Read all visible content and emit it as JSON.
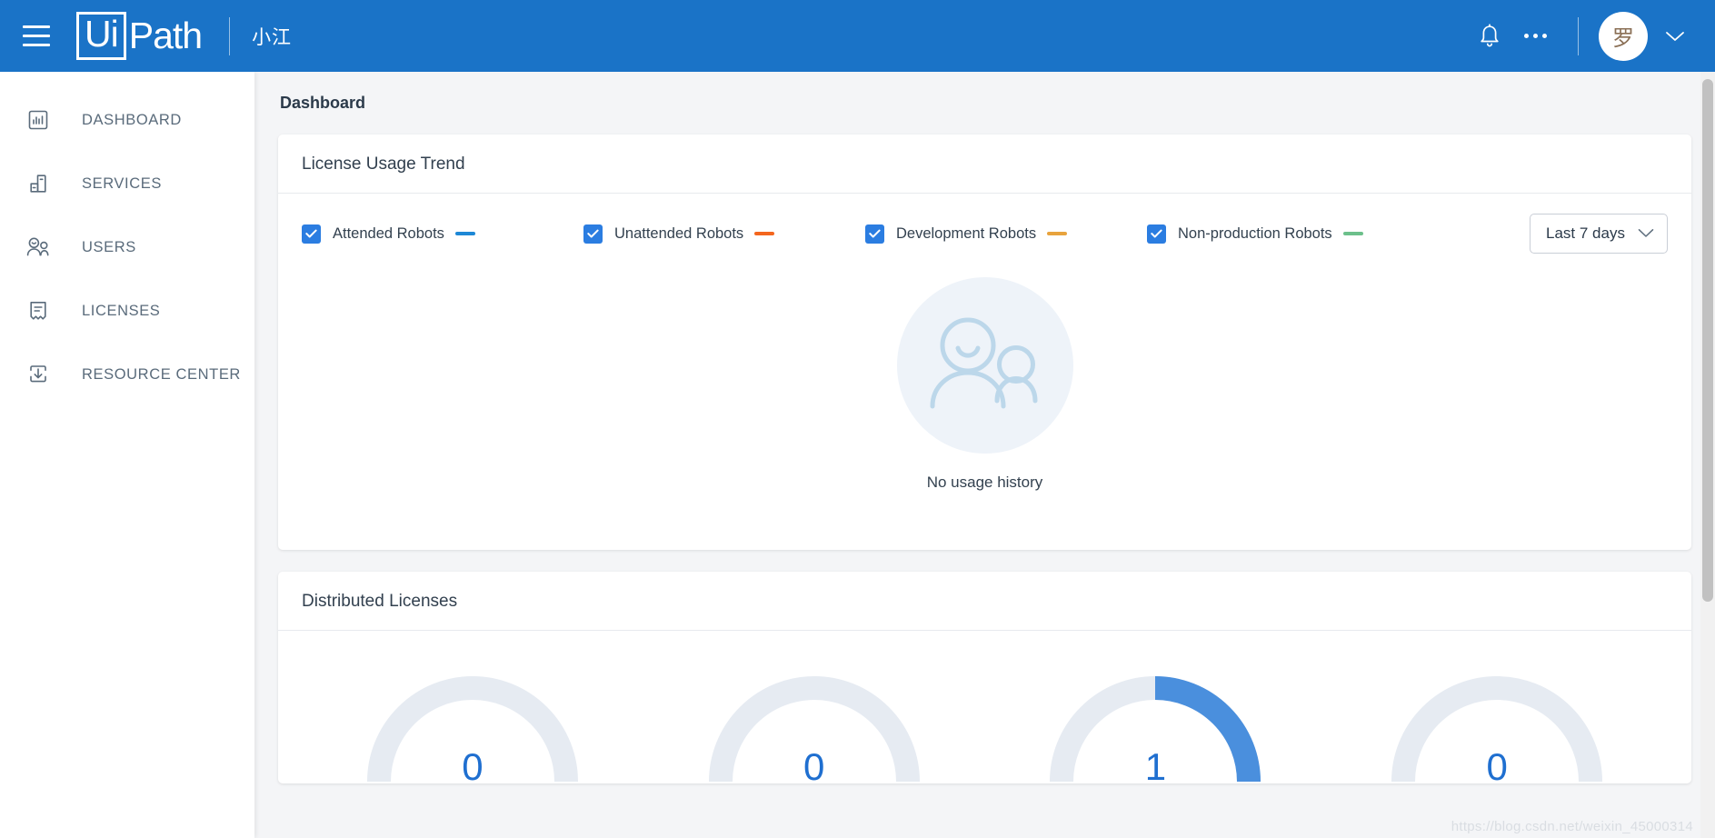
{
  "topbar": {
    "menu_icon": "hamburger-icon",
    "logo_mark": "Ui",
    "logo_word": "Path",
    "tenant": "小江",
    "notifications_icon": "bell-icon",
    "more_icon": "more-horizontal-icon",
    "avatar_initial": "罗",
    "account_caret_icon": "chevron-down-icon",
    "brand_color": "#1a73c7"
  },
  "sidebar": {
    "items": [
      {
        "label": "DASHBOARD",
        "icon": "chart-bars-icon"
      },
      {
        "label": "SERVICES",
        "icon": "services-blocks-icon"
      },
      {
        "label": "USERS",
        "icon": "users-icon"
      },
      {
        "label": "LICENSES",
        "icon": "license-ribbon-icon"
      },
      {
        "label": "RESOURCE CENTER",
        "icon": "download-box-icon"
      }
    ]
  },
  "page": {
    "title": "Dashboard"
  },
  "usage_card": {
    "title": "License Usage Trend",
    "legend": [
      {
        "label": "Attended Robots",
        "color": "#1e88d6",
        "checked": true
      },
      {
        "label": "Unattended Robots",
        "color": "#f4661e",
        "checked": true
      },
      {
        "label": "Development Robots",
        "color": "#e8a33d",
        "checked": true
      },
      {
        "label": "Non-production Robots",
        "color": "#6cc08b",
        "checked": true
      }
    ],
    "range_selected": "Last 7 days",
    "range_caret_icon": "chevron-down-icon",
    "empty_illustration": "two-people-icon",
    "empty_text": "No usage history"
  },
  "licenses_card": {
    "title": "Distributed Licenses",
    "gauges": [
      {
        "value": "0",
        "percent": 0
      },
      {
        "value": "0",
        "percent": 0
      },
      {
        "value": "1",
        "percent": 50
      },
      {
        "value": "0",
        "percent": 0
      }
    ]
  },
  "chart_data": {
    "type": "line",
    "title": "License Usage Trend",
    "series": [
      {
        "name": "Attended Robots",
        "color": "#1e88d6",
        "values": []
      },
      {
        "name": "Unattended Robots",
        "color": "#f4661e",
        "values": []
      },
      {
        "name": "Development Robots",
        "color": "#e8a33d",
        "values": []
      },
      {
        "name": "Non-production Robots",
        "color": "#6cc08b",
        "values": []
      }
    ],
    "x": [],
    "xlabel": "",
    "ylabel": "",
    "range": "Last 7 days",
    "empty_state": "No usage history",
    "legend_position": "top",
    "grid": false
  },
  "watermark": {
    "text": "https://blog.csdn.net/weixin_45000314"
  }
}
